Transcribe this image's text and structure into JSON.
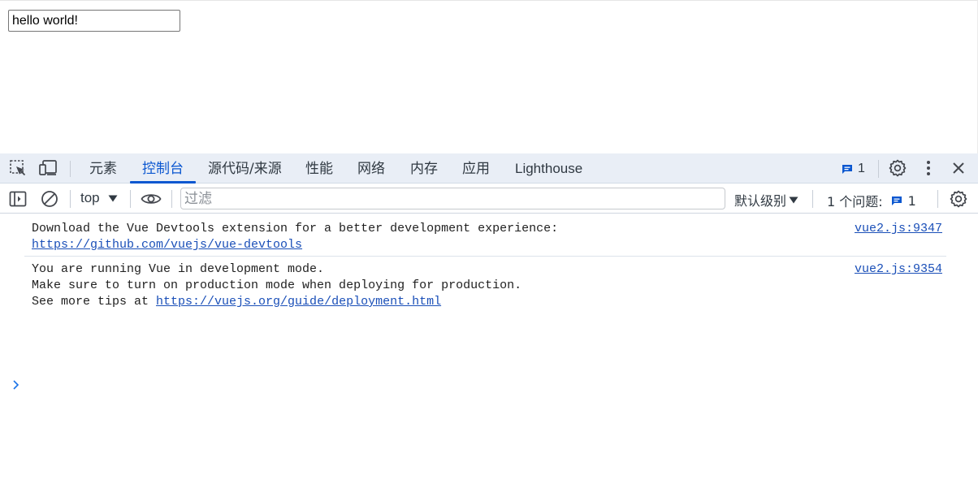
{
  "page": {
    "input_value": "hello world!"
  },
  "devtools": {
    "tabs": [
      {
        "label": "元素",
        "active": false
      },
      {
        "label": "控制台",
        "active": true
      },
      {
        "label": "源代码/来源",
        "active": false
      },
      {
        "label": "性能",
        "active": false
      },
      {
        "label": "网络",
        "active": false
      },
      {
        "label": "内存",
        "active": false
      },
      {
        "label": "应用",
        "active": false
      },
      {
        "label": "Lighthouse",
        "active": false
      }
    ],
    "issues_count": "1",
    "accent": "#0b57d0"
  },
  "console_toolbar": {
    "context": "top",
    "filter_placeholder": "过滤",
    "levels_label": "默认级别",
    "issues_label": "1 个问题:",
    "issues_count": "1"
  },
  "messages": [
    {
      "lines": [
        "Download the Vue Devtools extension for a better development experience:"
      ],
      "link": "https://github.com/vuejs/vue-devtools",
      "source": "vue2.js:9347"
    },
    {
      "lines": [
        "You are running Vue in development mode.",
        "Make sure to turn on production mode when deploying for production."
      ],
      "tip_prefix": "See more tips at ",
      "link": "https://vuejs.org/guide/deployment.html",
      "source": "vue2.js:9354"
    }
  ]
}
